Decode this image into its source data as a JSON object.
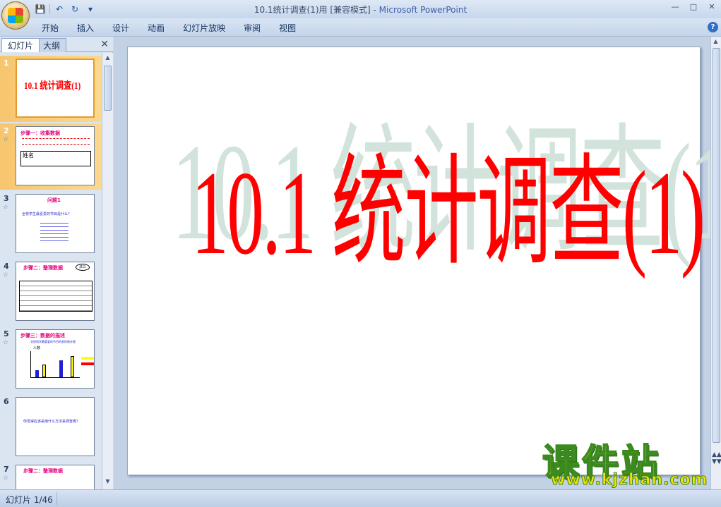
{
  "window": {
    "title_prefix": "10.1统计调查(1)用 [兼容模式] - ",
    "title_app": "Microsoft PowerPoint"
  },
  "qat": {
    "save": "save-icon",
    "undo": "undo-icon",
    "redo": "redo-icon",
    "customize": "▾"
  },
  "ribbon": {
    "tabs": [
      "开始",
      "插入",
      "设计",
      "动画",
      "幻灯片放映",
      "审阅",
      "视图"
    ]
  },
  "pane": {
    "tab_slides": "幻灯片",
    "tab_outline": "大纲",
    "close": "✕"
  },
  "thumbnails": [
    {
      "num": "1",
      "title": "10.1 统计调查(1)"
    },
    {
      "num": "2",
      "title": "步骤一：收集数据",
      "cell": "姓名"
    },
    {
      "num": "3",
      "title": "问题1",
      "line": "全校学生最喜爱的节目是什么？"
    },
    {
      "num": "4",
      "title": "步骤二：整理数据",
      "badge": "法三"
    },
    {
      "num": "5",
      "title": "步骤三：数据的描述",
      "sub": "全班同学最喜爱的节目的条形统计图",
      "y": "人数"
    },
    {
      "num": "6",
      "text": "你觉得应该采用什么方法来调查呢？"
    },
    {
      "num": "7",
      "title": "步骤二：整理数据"
    }
  ],
  "slide": {
    "title": "10.1 统计调查(1)"
  },
  "status": {
    "slide_pos": "幻灯片 1/46"
  },
  "watermark": {
    "cn": "课件站",
    "en": "www.kjzhan.com"
  }
}
